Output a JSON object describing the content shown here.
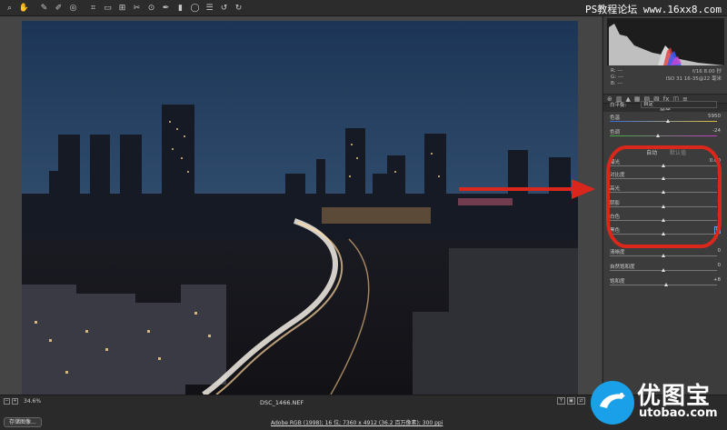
{
  "toolbar": {
    "tools": [
      {
        "icon": "zoom-icon",
        "glyph": "⌕"
      },
      {
        "icon": "hand-icon",
        "glyph": "✋"
      },
      {
        "icon": "white-balance-icon",
        "glyph": "✎"
      },
      {
        "icon": "color-sampler-icon",
        "glyph": "✐"
      },
      {
        "icon": "targeted-adjust-icon",
        "glyph": "◎"
      },
      {
        "icon": "crop-icon",
        "glyph": "⌗"
      },
      {
        "icon": "straighten-icon",
        "glyph": "▭"
      },
      {
        "icon": "transform-icon",
        "glyph": "⊞"
      },
      {
        "icon": "spot-removal-icon",
        "glyph": "✂"
      },
      {
        "icon": "red-eye-icon",
        "glyph": "⊙"
      },
      {
        "icon": "adjustment-brush-icon",
        "glyph": "✒"
      },
      {
        "icon": "graduated-filter-icon",
        "glyph": "▮"
      },
      {
        "icon": "radial-filter-icon",
        "glyph": "◯"
      },
      {
        "icon": "preferences-icon",
        "glyph": "☰"
      },
      {
        "icon": "rotate-left-icon",
        "glyph": "↺"
      },
      {
        "icon": "rotate-right-icon",
        "glyph": "↻"
      }
    ]
  },
  "watermark": "PS教程论坛 www.16xx8.com",
  "histogram": {
    "rgb": [
      "R: ---",
      "G: ---",
      "B: ---"
    ],
    "exif_line1": "f/16   8.00 秒",
    "exif_line2": "ISO 31   16-35@22 毫米"
  },
  "panel": {
    "tab_icons": [
      "⊛",
      "▥",
      "▲",
      "▦",
      "▤",
      "▧",
      "fx",
      "◫",
      "≡"
    ],
    "section_title": "基本",
    "white_balance_label": "白平衡:",
    "white_balance_value": "自定",
    "temperature": {
      "label": "色温",
      "value": "5950",
      "level": 0.55
    },
    "tint": {
      "label": "色调",
      "value": "-24",
      "level": 0.45
    },
    "auto_label": "自动",
    "default_label": "默认值",
    "exposure": {
      "label": "曝光",
      "value": "0.00",
      "level": 0.5
    },
    "contrast": {
      "label": "对比度",
      "value": "0",
      "level": 0.5
    },
    "highlights": {
      "label": "高光",
      "value": "0",
      "level": 0.5
    },
    "shadows": {
      "label": "阴影",
      "value": "0",
      "level": 0.5
    },
    "whites": {
      "label": "白色",
      "value": "0",
      "level": 0.5
    },
    "blacks": {
      "label": "黑色",
      "value": "0",
      "level": 0.5
    },
    "clarity": {
      "label": "清晰度",
      "value": "0",
      "level": 0.5
    },
    "vibrance": {
      "label": "自然饱和度",
      "value": "0",
      "level": 0.5
    },
    "saturation": {
      "label": "饱和度",
      "value": "+8",
      "level": 0.53
    }
  },
  "bottom": {
    "zoom_minus": "−",
    "zoom_plus": "+",
    "zoom_value": "34.6%",
    "filename": "DSC_1466.NEF",
    "view_buttons": [
      "Y",
      "▣",
      "⇄"
    ],
    "save_label": "存储图像...",
    "workflow": "Adobe RGB (1998); 16 位; 7360 x 4912 (36.2 百万像素); 300 ppi"
  },
  "logo": {
    "text": "优图宝",
    "url": "utobao.com"
  },
  "colors": {
    "annotation_red": "#d9281b",
    "logo_blue": "#1aa0e8"
  }
}
